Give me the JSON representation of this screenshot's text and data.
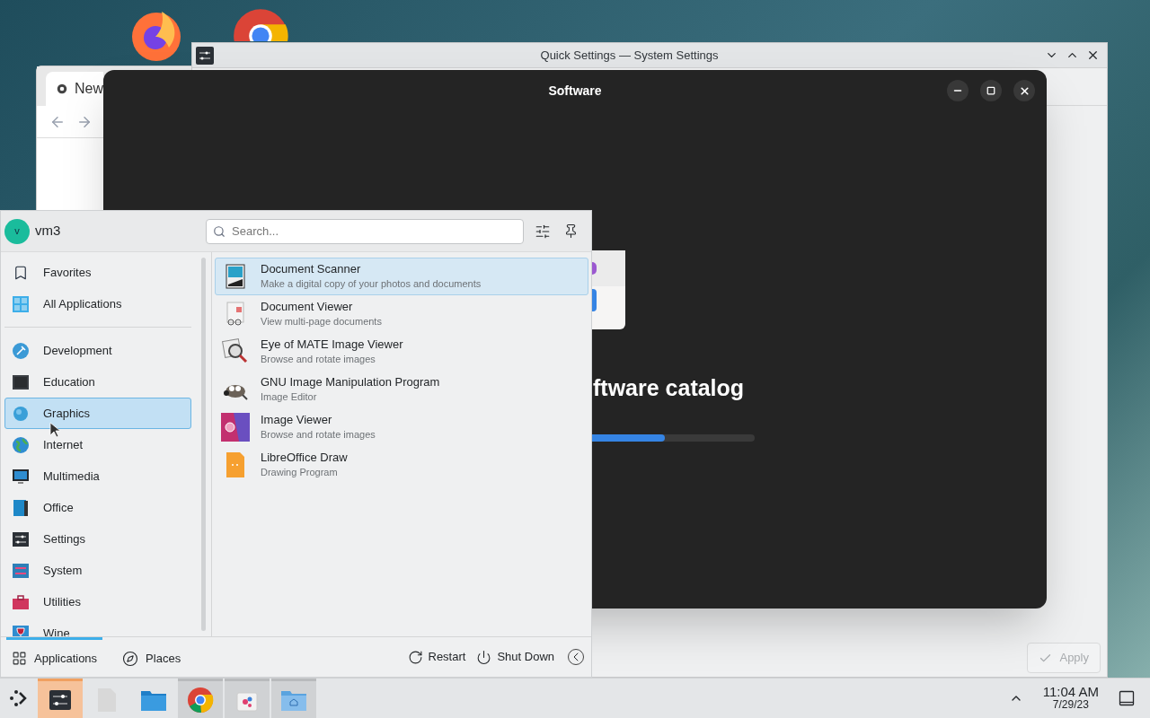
{
  "browser_window": {
    "tab_title": "New"
  },
  "settings_window": {
    "title": "Quick Settings — System Settings",
    "apply_button": {
      "label": "Apply",
      "disabled": true
    }
  },
  "software_window": {
    "title": "Software",
    "heading": "ftware catalog",
    "progress": {
      "level": 0.75
    }
  },
  "launcher": {
    "user": {
      "initial": "v",
      "name": "vm3"
    },
    "search": {
      "placeholder": "Search..."
    },
    "categories": [
      {
        "label": "Favorites",
        "selected": false
      },
      {
        "label": "All Applications",
        "selected": false
      },
      {
        "label": "Development",
        "selected": false
      },
      {
        "label": "Education",
        "selected": false
      },
      {
        "label": "Graphics",
        "selected": true
      },
      {
        "label": "Internet",
        "selected": false
      },
      {
        "label": "Multimedia",
        "selected": false
      },
      {
        "label": "Office",
        "selected": false
      },
      {
        "label": "Settings",
        "selected": false
      },
      {
        "label": "System",
        "selected": false
      },
      {
        "label": "Utilities",
        "selected": false
      },
      {
        "label": "Wine",
        "selected": false
      }
    ],
    "apps": [
      {
        "name": "Document Scanner",
        "description": "Make a digital copy of your photos and documents",
        "selected": true
      },
      {
        "name": "Document Viewer",
        "description": "View multi-page documents",
        "selected": false
      },
      {
        "name": "Eye of MATE Image Viewer",
        "description": "Browse and rotate images",
        "selected": false
      },
      {
        "name": "GNU Image Manipulation Program",
        "description": "Image Editor",
        "selected": false
      },
      {
        "name": "Image Viewer",
        "description": "Browse and rotate images",
        "selected": false
      },
      {
        "name": "LibreOffice Draw",
        "description": "Drawing Program",
        "selected": false
      }
    ],
    "tabs": [
      {
        "label": "Applications",
        "selected": true
      },
      {
        "label": "Places",
        "selected": false
      }
    ],
    "actions": [
      {
        "kind": "restart",
        "label": "Restart"
      },
      {
        "kind": "shutdown",
        "label": "Shut Down"
      }
    ]
  },
  "taskbar": {
    "tasks": [
      {
        "kind": "settings",
        "active": true,
        "open": true
      },
      {
        "kind": "file",
        "active": false,
        "open": false
      },
      {
        "kind": "folder",
        "active": false,
        "open": false
      },
      {
        "kind": "browser",
        "active": false,
        "open": true
      },
      {
        "kind": "store",
        "active": false,
        "open": true
      },
      {
        "kind": "home-folder",
        "active": false,
        "open": true
      }
    ],
    "time": "11:04 AM",
    "date": "7/29/23"
  }
}
